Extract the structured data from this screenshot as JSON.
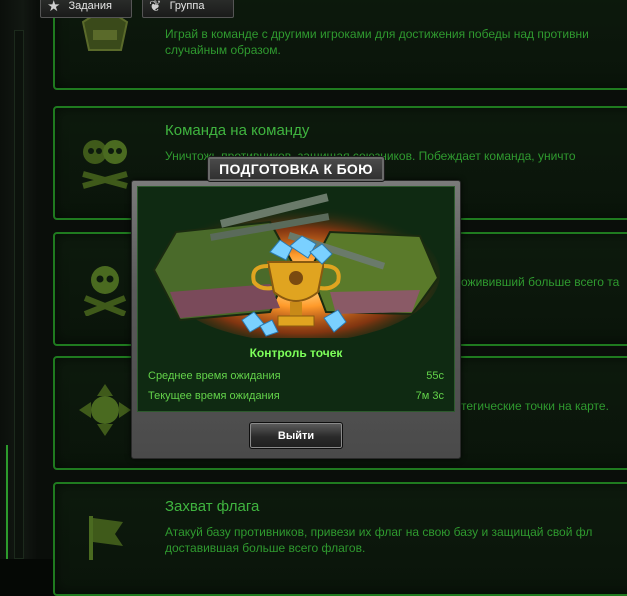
{
  "tabs": [
    {
      "label": "Задания",
      "icon": "star-icon"
    },
    {
      "label": "Группа",
      "icon": "group-icon"
    }
  ],
  "modes": [
    {
      "title": "",
      "desc_lines": [
        "Играй в команде с другими игроками для достижения победы над противни",
        "случайным образом."
      ],
      "icon": "tank-insignia-icon"
    },
    {
      "title": "Команда на команду",
      "desc_lines": [
        "Уничтожь противников, защищая союзников. Побеждает команда, уничто"
      ],
      "icon": "double-skull-icon"
    },
    {
      "title": "",
      "desc_lines": [
        "",
        "ожививший больше всего та"
      ],
      "icon": "skull-crossbones-icon"
    },
    {
      "title": "",
      "desc_lines": [
        "",
        "тегические точки на карте."
      ],
      "icon": "control-points-icon"
    },
    {
      "title": "Захват флага",
      "desc_lines": [
        "Атакуй базу противников, привези их флаг на свою базу и защищай свой фл",
        "доставившая больше всего флагов."
      ],
      "icon": "flag-icon"
    }
  ],
  "dialog": {
    "title": "ПОДГОТОВКА К БОЮ",
    "mode_name": "Контроль точек",
    "avg_wait_label": "Среднее время ожидания",
    "avg_wait_value": "55с",
    "cur_wait_label": "Текущее время ожидания",
    "cur_wait_value": "7м 3с",
    "exit_label": "Выйти"
  },
  "colors": {
    "card_border": "#1f7a1f",
    "card_text": "#2f9a2f",
    "title_green": "#3fb43f",
    "mode_name": "#7dff5a"
  }
}
